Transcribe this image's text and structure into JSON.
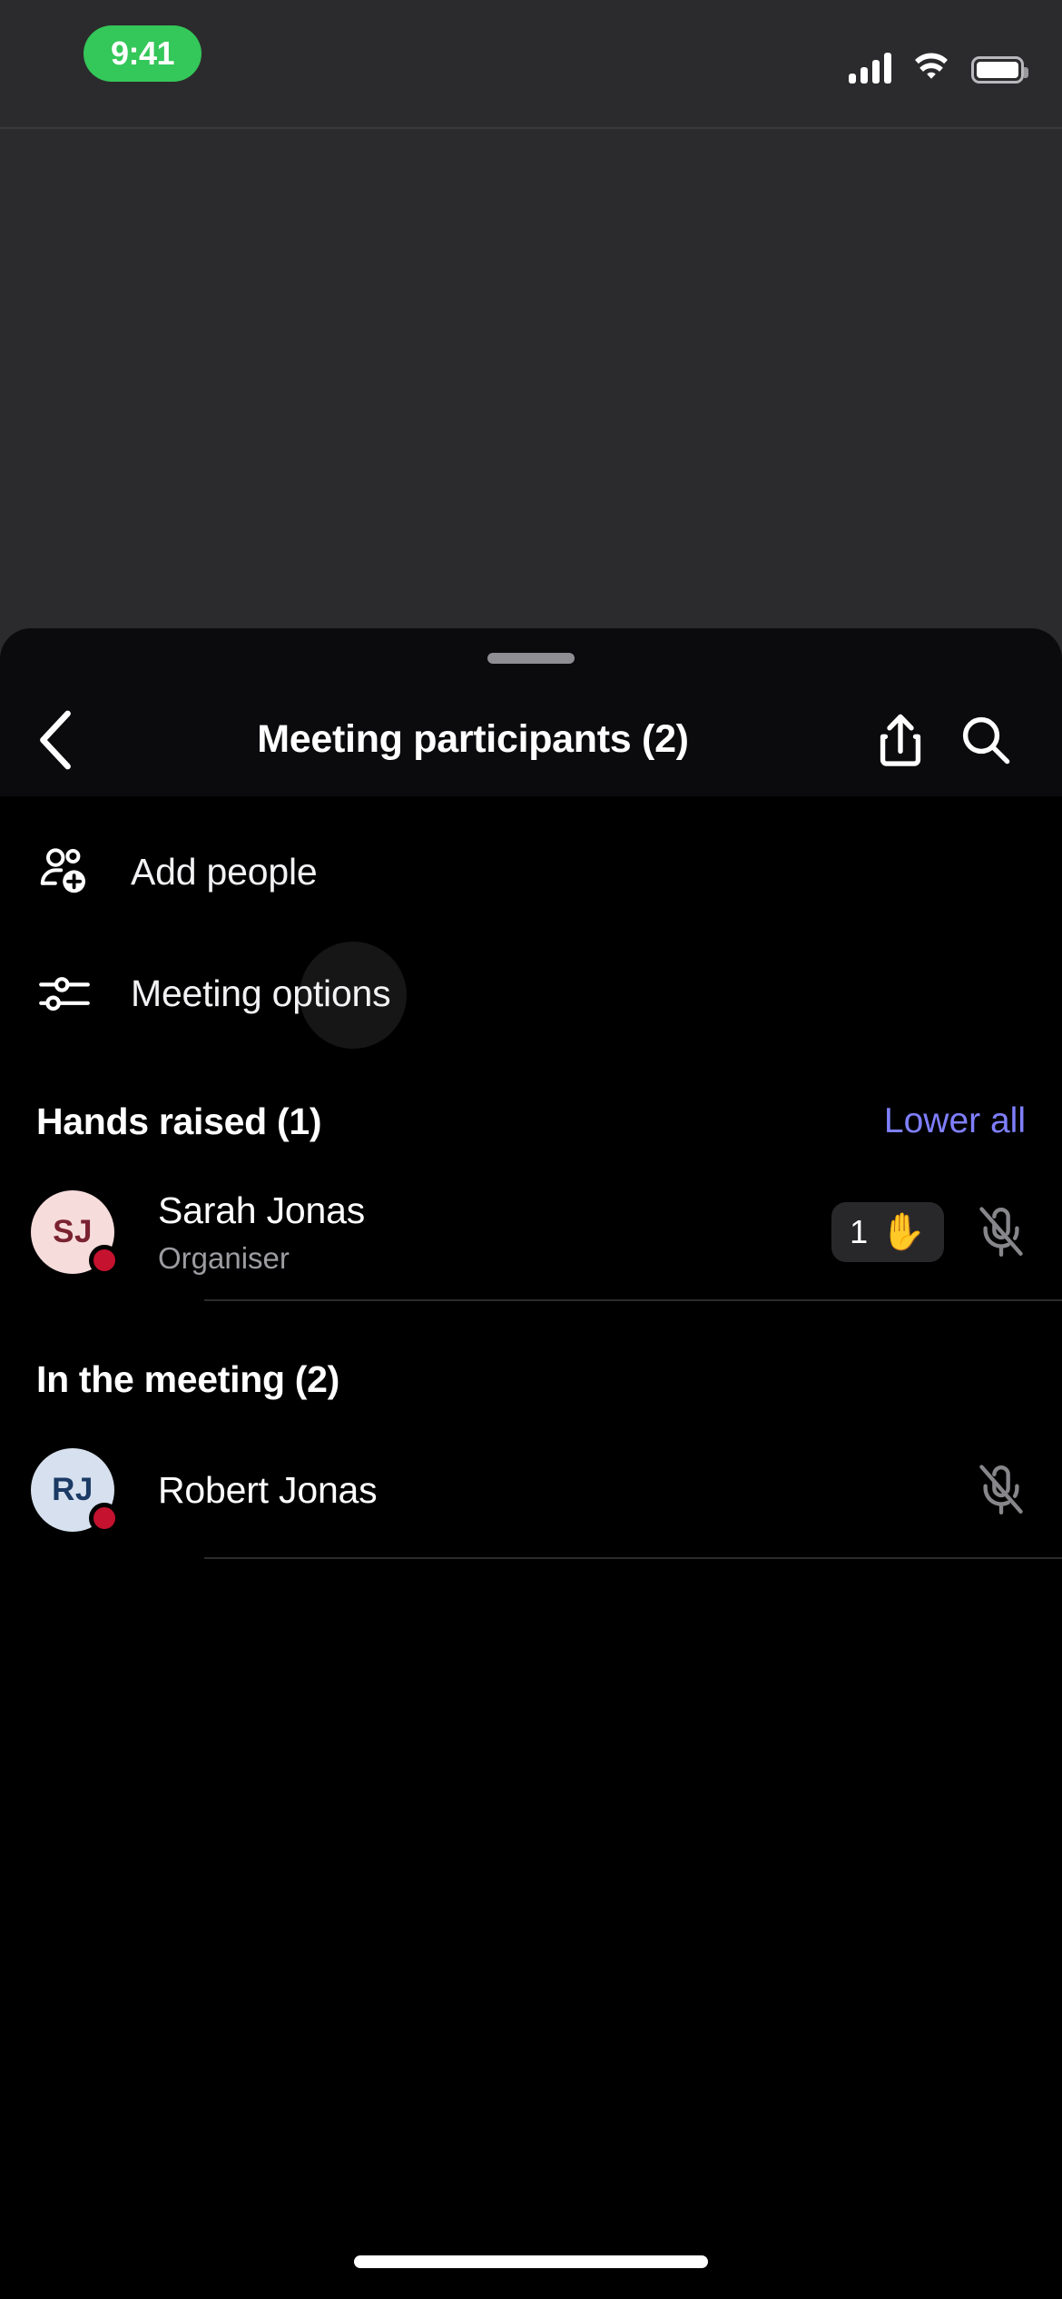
{
  "status_bar": {
    "time": "9:41",
    "call_pill_color": "#34c759",
    "signal_icon": "cellular-signal-icon",
    "wifi_icon": "wifi-icon",
    "battery_icon": "battery-full-icon"
  },
  "sheet": {
    "grabber": "drag-handle",
    "back_icon": "chevron-left-icon",
    "title": "Meeting participants (2)",
    "share_icon": "share-icon",
    "search_icon": "search-icon"
  },
  "actions": [
    {
      "id": "add-people",
      "label": "Add people",
      "icon": "person-add-icon"
    },
    {
      "id": "meeting-options",
      "label": "Meeting options",
      "icon": "sliders-icon"
    }
  ],
  "sections": [
    {
      "id": "hands-raised",
      "title": "Hands raised (1)",
      "action_label": "Lower all",
      "action_color": "#7f7fff",
      "participants": [
        {
          "name": "Sarah Jonas",
          "role": "Organiser",
          "initials": "SJ",
          "avatar_bg": "#f7dcdc",
          "avatar_fg": "#7a2230",
          "presence": "busy",
          "presence_color": "#c4122f",
          "hand_raised": true,
          "hand_count": "1",
          "hand_emoji": "✋",
          "mic_state": "muted",
          "mic_icon": "mic-off-icon"
        }
      ]
    },
    {
      "id": "in-the-meeting",
      "title": "In the meeting (2)",
      "action_label": "",
      "participants": [
        {
          "name": "Robert Jonas",
          "role": "",
          "initials": "RJ",
          "avatar_bg": "#d6e0ef",
          "avatar_fg": "#1b3a64",
          "presence": "busy",
          "presence_color": "#c4122f",
          "hand_raised": false,
          "hand_count": "",
          "hand_emoji": "",
          "mic_state": "muted",
          "mic_icon": "mic-off-icon"
        }
      ]
    }
  ],
  "home_indicator": "home-indicator"
}
